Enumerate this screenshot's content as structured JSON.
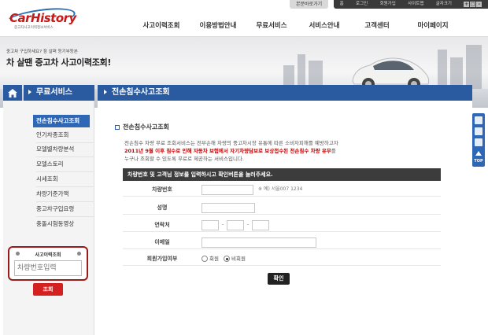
{
  "topbar": {
    "main_shortcut": "본문바로가기",
    "home": "홈",
    "login": "로그인",
    "join": "회원가입",
    "sitemap": "사이트맵",
    "font_size": "글자크기",
    "zoom_in": "+",
    "zoom_reset": "□",
    "zoom_out": "-"
  },
  "logo": {
    "text": "CarHistory",
    "subtitle": "중고차사고이력정보서비스"
  },
  "gnb": {
    "items": [
      "사고이력조회",
      "이용방법안내",
      "무료서비스",
      "서비스안내",
      "고객센터",
      "마이페이지"
    ]
  },
  "hero": {
    "small": "중고차 구입하세요? 잠 살펴 등기부등본",
    "big": "차 살땐 중고차 사고이력조회!"
  },
  "sidebar": {
    "title": "무료서비스",
    "items": [
      {
        "label": "전손침수사고조회",
        "active": true
      },
      {
        "label": "인기차종조회"
      },
      {
        "label": "모델별차량분석"
      },
      {
        "label": "모델스토리"
      },
      {
        "label": "시세조회"
      },
      {
        "label": "차량기준가액"
      },
      {
        "label": "중고차구입요령"
      },
      {
        "label": "충돌시험동영상"
      }
    ],
    "search": {
      "title": "사고이력조회",
      "placeholder": "차량번호입력",
      "button": "조회"
    }
  },
  "content": {
    "header": "전손침수사고조회",
    "section_title": "전손침수사고조회",
    "desc_line1": "전손침수 차량 무료 조회서비스는 전부손해 차량의 중고차시장 유통에 따른 소비자피해를 예방하고자",
    "desc_line2": "2011년 9월 이후 침수로 인해 자동차 보험에서 자기차량담보로 보상접수된 전손침수 차량 유무",
    "desc_line2_suffix": "를",
    "desc_line3": "누구나 조회할 수 있도록 무료로 제공하는 서비스입니다.",
    "notice": "차량번호 및 고객님 정보를 입력하시고 확인버튼을 눌러주세요.",
    "form": {
      "car_number_label": "차량번호",
      "car_number_hint": "※ 예) 서울007 1234",
      "name_label": "성명",
      "phone_label": "연락처",
      "phone_dash": "-",
      "email_label": "이메일",
      "member_label": "회원가입여부",
      "member_yes": "회원",
      "member_no": "비회원",
      "member_selected": "비회원"
    },
    "confirm_button": "확인"
  },
  "quickbar": {
    "top_label": "TOP"
  },
  "colors": {
    "brand_blue": "#2a5aa0",
    "active_blue": "#2f67b7",
    "accent_red": "#cc0000",
    "search_border": "#9b1b1b",
    "search_button": "#d42020"
  }
}
